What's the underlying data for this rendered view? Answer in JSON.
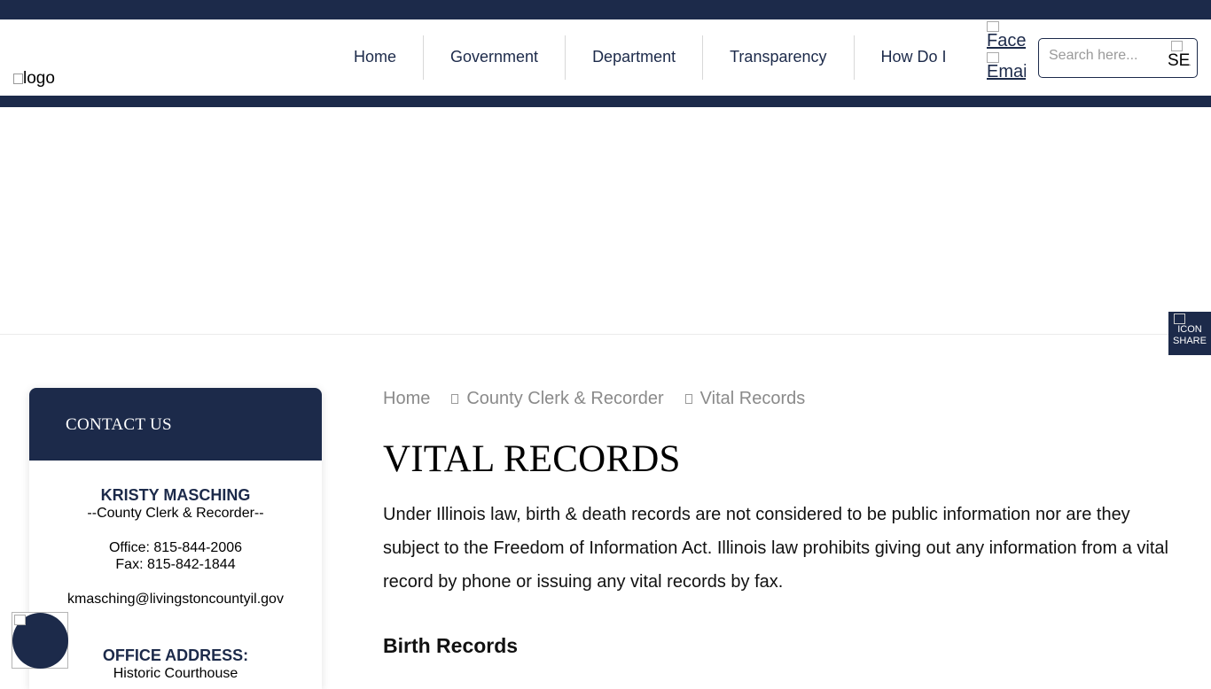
{
  "header": {
    "logo_alt": "logo",
    "nav": [
      "Home",
      "Government",
      "Department",
      "Transparency",
      "How Do I"
    ],
    "social": {
      "facebook_alt": "Facebook",
      "email_alt": "Email"
    },
    "search": {
      "placeholder": "Search here...",
      "button_alt": "SEARCH"
    }
  },
  "share": {
    "icon_alt": "ICON",
    "label": "SHARE"
  },
  "contact": {
    "heading": "CONTACT US",
    "name": "KRISTY MASCHING",
    "title": "--County Clerk & Recorder--",
    "office": "Office: 815-844-2006",
    "fax": "Fax: 815-842-1844",
    "email": "kmasching@livingstoncountyil.gov",
    "address_heading": "OFFICE ADDRESS:",
    "address_line1": "Historic Courthouse"
  },
  "breadcrumb": [
    "Home",
    "County Clerk & Recorder",
    "Vital Records"
  ],
  "page": {
    "title": "VITAL RECORDS",
    "intro": "Under Illinois law, birth & death records are not considered to be public information nor are they subject to the Freedom of Information Act. Illinois law prohibits giving out any information from a vital record by phone or issuing any vital records by fax.",
    "section1": "Birth Records"
  },
  "colors": {
    "navy": "#1c2a4a",
    "breadcrumb_gray": "#8a8a8a"
  }
}
